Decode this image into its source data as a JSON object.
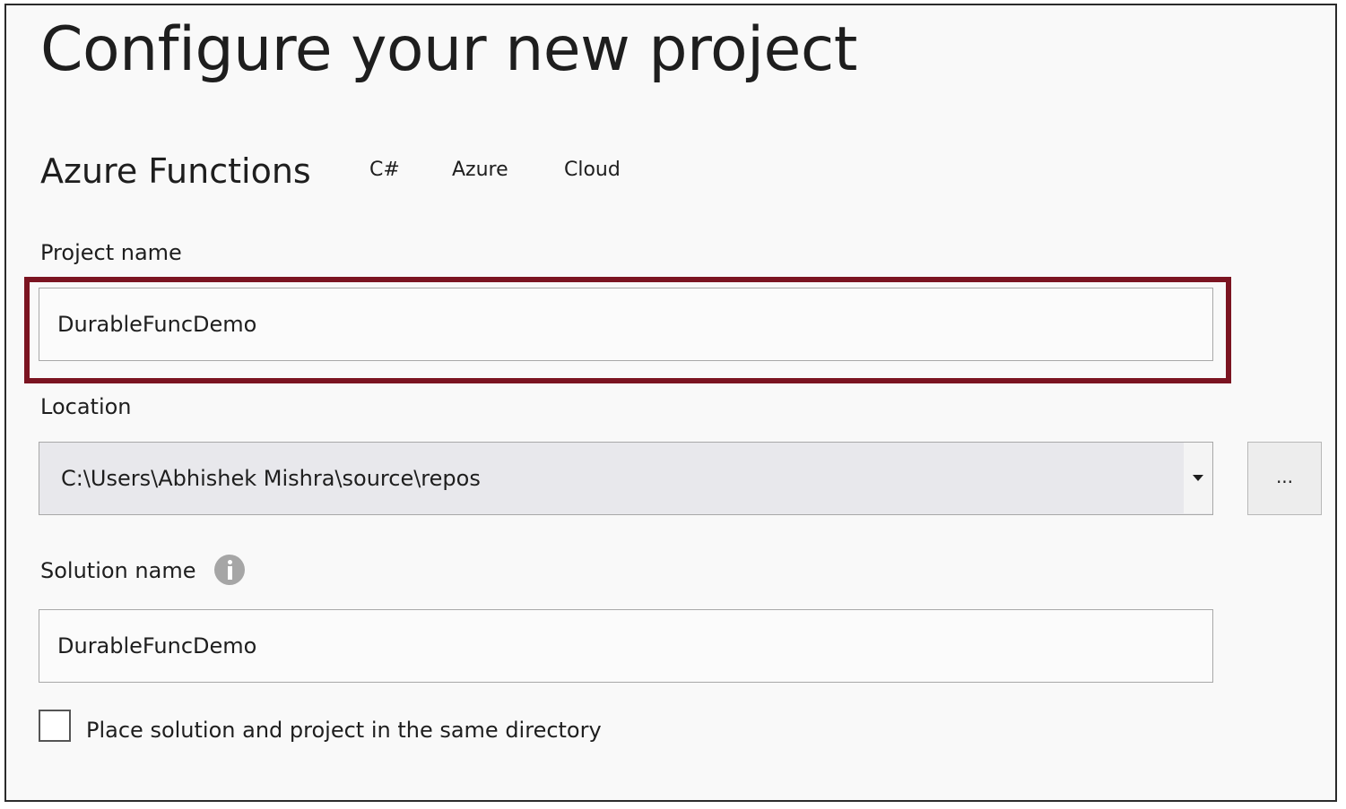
{
  "page": {
    "title": "Configure your new project"
  },
  "template": {
    "name": "Azure Functions",
    "tags": [
      "C#",
      "Azure",
      "Cloud"
    ]
  },
  "project_name": {
    "label": "Project name",
    "value": "DurableFuncDemo",
    "highlighted": true,
    "highlight_color": "#7b1421"
  },
  "location": {
    "label": "Location",
    "value": "C:\\Users\\Abhishek Mishra\\source\\repos",
    "browse_label": "..."
  },
  "solution_name": {
    "label": "Solution name",
    "info_icon": "info-icon",
    "value": "DurableFuncDemo"
  },
  "same_directory": {
    "label": "Place solution and project in the same directory",
    "checked": false
  },
  "icons": {
    "dropdown": "chevron-down-icon",
    "info": "info-icon"
  }
}
